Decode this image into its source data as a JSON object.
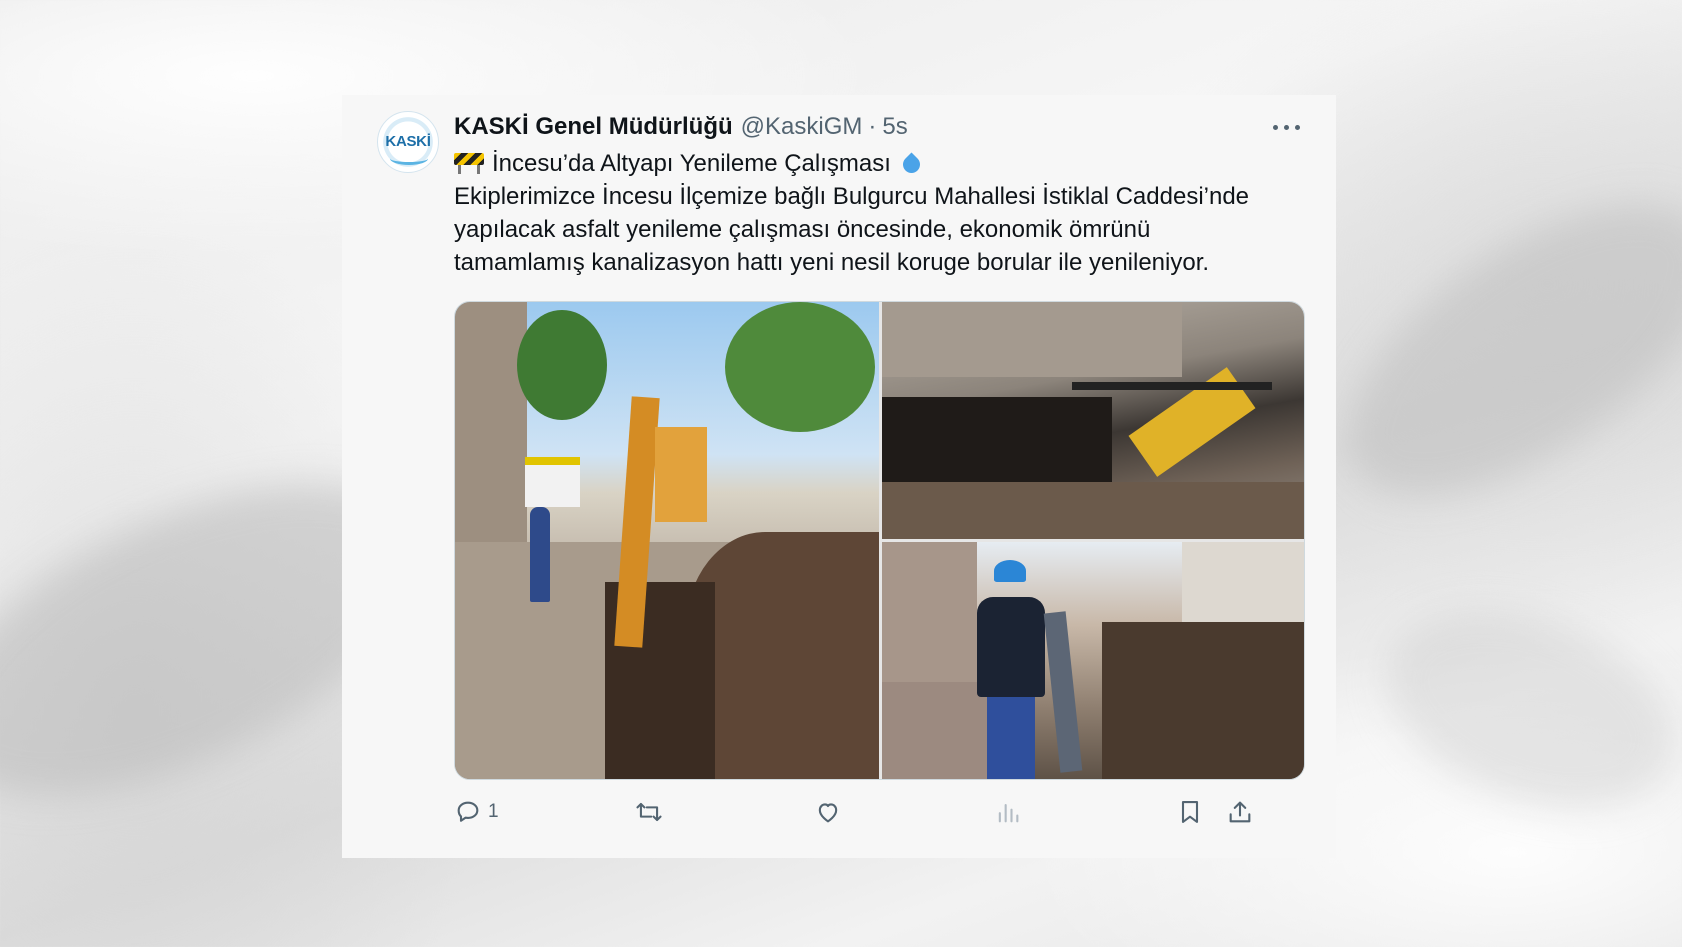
{
  "tweet": {
    "author_name": "KASKİ Genel Müdürlüğü",
    "handle": "@KaskiGM",
    "separator": "·",
    "time": "5s",
    "avatar_text": "KASKİ",
    "title_line": "İncesu’da Altyapı Yenileme Çalışması",
    "body_lines": [
      "Ekiplerimizce İncesu İlçemize bağlı Bulgurcu Mahallesi İstiklal Caddesi’nde",
      "yapılacak asfalt yenileme çalışması öncesinde, ekonomik ömrünü",
      "tamamlamış kanalizasyon hattı yeni nesil koruge borular ile yenileniyor."
    ],
    "icons": {
      "title_prefix": "construction-barrier-icon",
      "title_suffix": "droplet-icon",
      "more": "more-dots-icon"
    },
    "media": [
      {
        "name": "excavator-street-photo"
      },
      {
        "name": "trench-aerial-photo"
      },
      {
        "name": "worker-pipe-photo"
      }
    ],
    "actions": {
      "reply_count": "1",
      "reply_icon": "reply-icon",
      "retweet_icon": "retweet-icon",
      "like_icon": "heart-icon",
      "views_icon": "views-chart-icon",
      "bookmark_icon": "bookmark-icon",
      "share_icon": "share-icon"
    }
  },
  "colors": {
    "text_primary": "#0f1419",
    "text_secondary": "#536471",
    "card_bg": "#f7f7f7",
    "drop_blue": "#4aa3e8"
  }
}
